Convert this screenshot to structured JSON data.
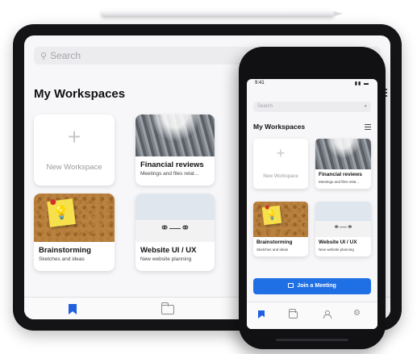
{
  "tablet": {
    "search_placeholder": "Search",
    "section_title": "My Workspaces",
    "new_workspace_label": "New Workspace",
    "cards": [
      {
        "title": "Financial reviews",
        "subtitle": "Meetings and files relat..."
      },
      {
        "title": "Brainstorming",
        "subtitle": "Sketches and ideas"
      },
      {
        "title": "Website UI / UX",
        "subtitle": "New website planning"
      }
    ],
    "tabbar": [
      "bookmark-icon",
      "folder-icon"
    ]
  },
  "phone": {
    "status_time": "9:41",
    "search_placeholder": "Search",
    "section_title": "My Workspaces",
    "new_workspace_label": "New Workspace",
    "cards": [
      {
        "title": "Financial reviews",
        "subtitle": "Meetings and files relat..."
      },
      {
        "title": "Brainstorming",
        "subtitle": "Sketches and ideas"
      },
      {
        "title": "Website UI / UX",
        "subtitle": "New website planning"
      }
    ],
    "join_button_label": "Join a Meeting",
    "tabbar": [
      "bookmark-icon",
      "folder-icon",
      "person-icon",
      "gear-icon"
    ]
  },
  "colors": {
    "accent": "#1f6fe5",
    "background": "#f7f7f9",
    "device": "#141416"
  }
}
